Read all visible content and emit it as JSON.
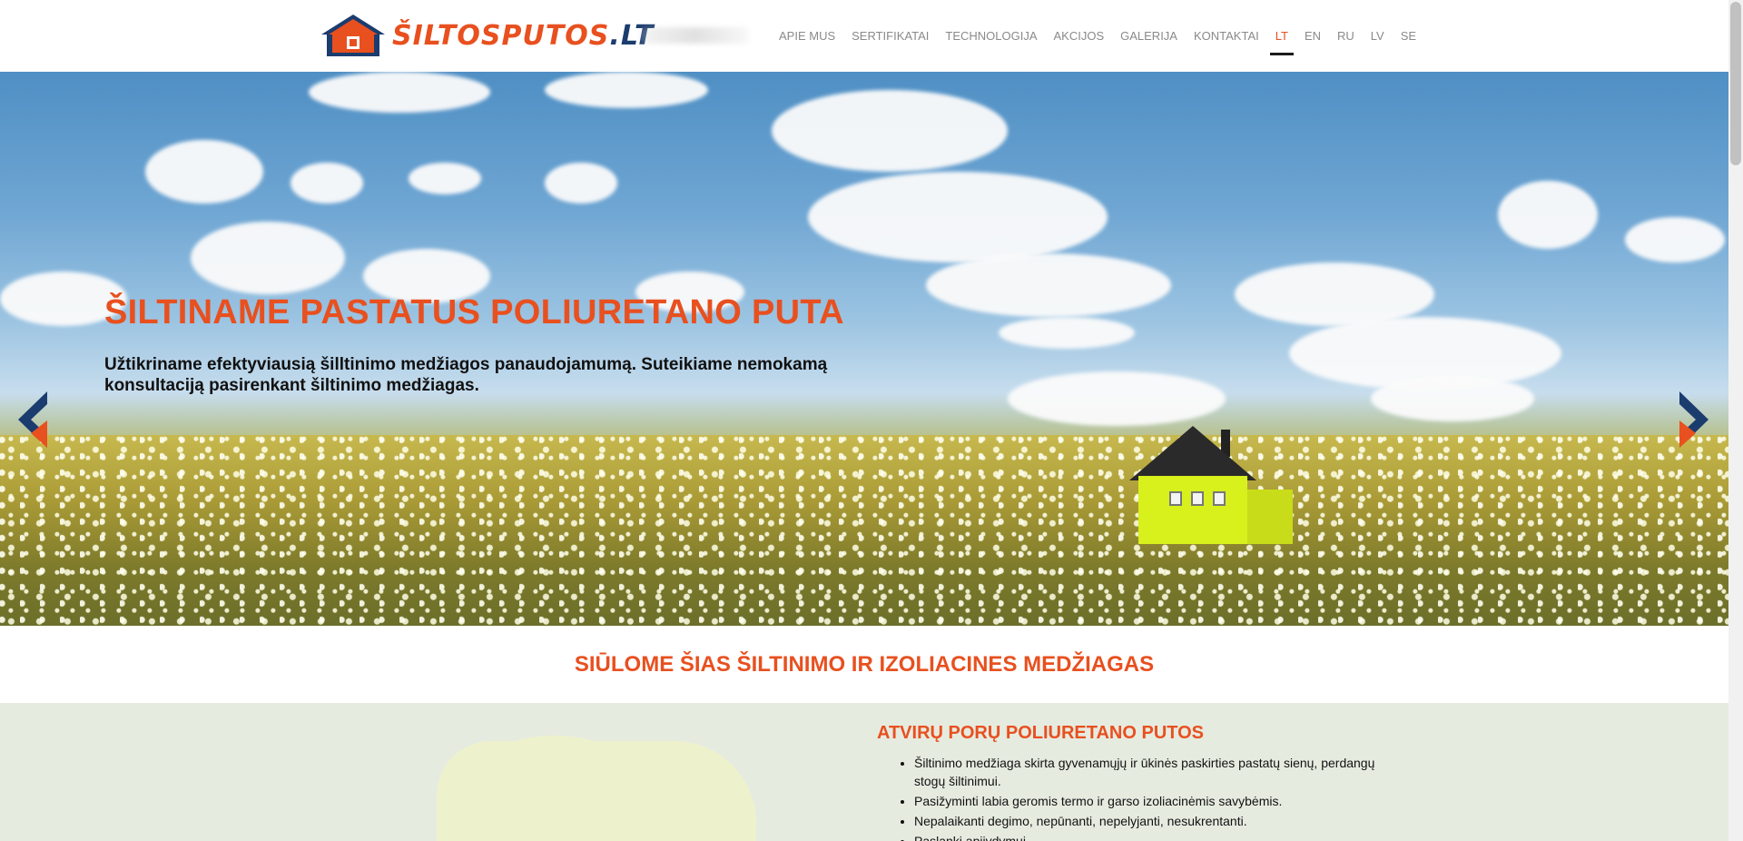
{
  "logo": {
    "name": "ŠILTOSPUTOS",
    "tld": ".LT"
  },
  "nav": {
    "items": [
      {
        "label": "APIE MUS"
      },
      {
        "label": "SERTIFIKATAI"
      },
      {
        "label": "TECHNOLOGIJA"
      },
      {
        "label": "AKCIJOS"
      },
      {
        "label": "GALERIJA"
      },
      {
        "label": "KONTAKTAI"
      }
    ],
    "languages": [
      {
        "label": "LT",
        "active": true
      },
      {
        "label": "EN"
      },
      {
        "label": "RU"
      },
      {
        "label": "LV"
      },
      {
        "label": "SE"
      }
    ]
  },
  "hero": {
    "title": "ŠILTINAME PASTATUS POLIURETANO PUTA",
    "subtitle": "Užtikriname efektyviausią šilltinimo medžiagos panaudojamumą. Suteikiame nemokamą konsultaciją pasirenkant šiltinimo medžiagas.",
    "slide_count": 5,
    "active_slide": 1
  },
  "section": {
    "title": "SIŪLOME ŠIAS ŠILTINIMO IR IZOLIACINES MEDŽIAGAS"
  },
  "product": {
    "title": "ATVIRŲ PORŲ POLIURETANO PUTOS",
    "bullets": [
      "Šiltinimo medžiaga skirta gyvenamųjų ir ūkinės paskirties pastatų sienų, perdangų stogų šiltinimui.",
      "Pasižymintі labia geromis termo ir garso izoliacinėmis savybėmis.",
      "Nepalaikanti degimo, nepūnanti, nepelyjanti, nesukrentanti.",
      "Paslanki apiivdymui"
    ]
  },
  "colors": {
    "accent": "#e8501f",
    "navy": "#1b3c6e",
    "nav_text": "#8a8a8a"
  }
}
